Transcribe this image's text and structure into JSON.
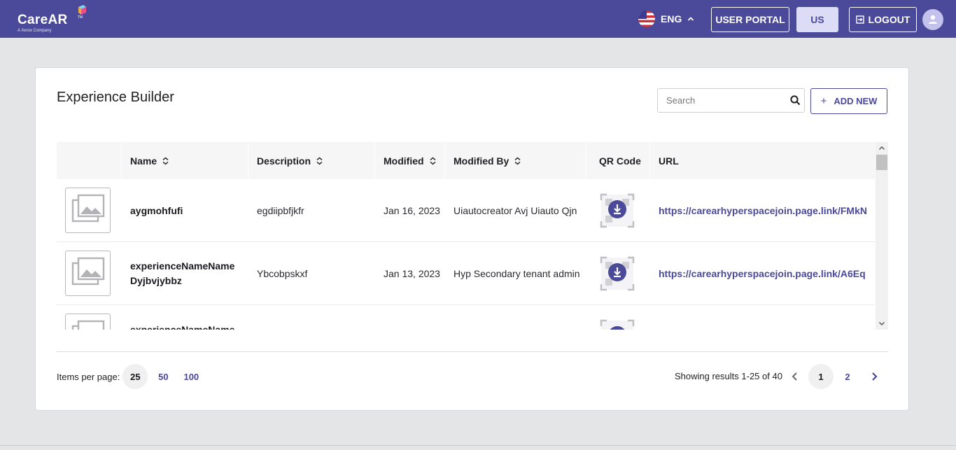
{
  "header": {
    "logo_text": "CareAR",
    "logo_tagline": "A Xerox Company",
    "logo_tm": "TM",
    "language": "ENG",
    "user_portal_label": "USER PORTAL",
    "region_label": "US",
    "logout_label": "LOGOUT"
  },
  "page": {
    "title": "Experience Builder",
    "search_placeholder": "Search",
    "add_new_label": "ADD NEW"
  },
  "table": {
    "columns": [
      "",
      "Name",
      "Description",
      "Modified",
      "Modified By",
      "QR Code",
      "URL"
    ],
    "rows": [
      {
        "name": "aygmohfufi",
        "description": "egdiipbfjkfr",
        "modified": "Jan 16, 2023",
        "modified_by": "Uiautocreator Avj Uiauto Qjn",
        "url": "https://carearhyperspacejoin.page.link/FMkN"
      },
      {
        "name": "experienceNameName Dyjbvjybbz",
        "description": "Ybcobpskxf",
        "modified": "Jan 13, 2023",
        "modified_by": "Hyp Secondary tenant admin",
        "url": "https://carearhyperspacejoin.page.link/A6Eq"
      },
      {
        "name": "experienceNameName",
        "description": "",
        "modified": "",
        "modified_by": "",
        "url": ""
      }
    ]
  },
  "footer": {
    "items_per_page_label": "Items per page:",
    "items_per_page_options": [
      "25",
      "50",
      "100"
    ],
    "items_per_page_selected": "25",
    "results_text": "Showing results 1-25 of 40",
    "pages": [
      "1",
      "2"
    ],
    "current_page": "1"
  },
  "colors": {
    "brand": "#4b4999",
    "background": "#e4e5e7",
    "card": "#ffffff"
  }
}
